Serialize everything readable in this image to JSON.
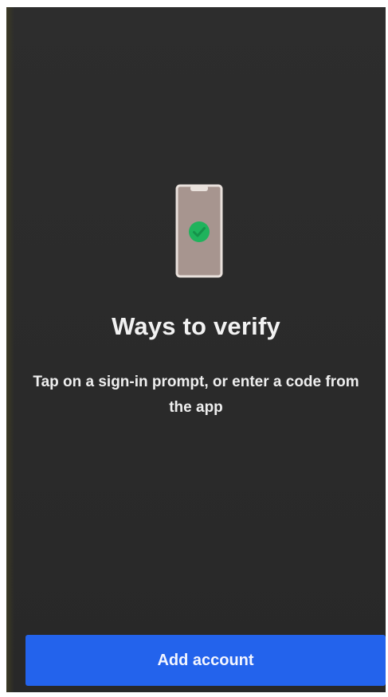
{
  "onboarding": {
    "illustration_icon": "phone-check-icon",
    "title": "Ways to verify",
    "subtitle": "Tap on a sign-in prompt, or enter a code from the app",
    "add_account_label": "Add account"
  },
  "colors": {
    "background": "#2b2b2b",
    "button": "#2363ec",
    "check_green": "#1fb35c",
    "phone_fill": "#a7958f",
    "phone_border": "#e9e1dc"
  }
}
